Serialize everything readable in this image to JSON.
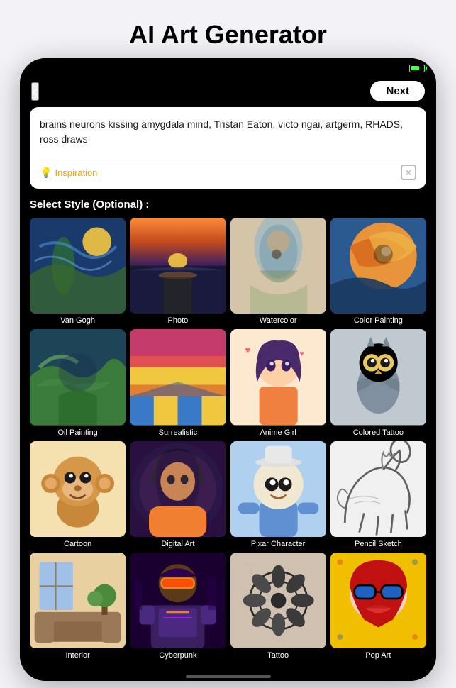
{
  "page": {
    "title": "AI Art Generator"
  },
  "nav": {
    "back_label": "‹",
    "next_label": "Next"
  },
  "prompt": {
    "text": "brains neurons kissing amygdala mind, Tristan Eaton, victo ngai, artgerm, RHADS, ross draws",
    "inspiration_label": "Inspiration",
    "clear_label": "×"
  },
  "styles": {
    "section_label": "Select Style (Optional) :",
    "items": [
      {
        "id": "vangogh",
        "name": "Van Gogh",
        "thumb_class": "thumb-vangogh"
      },
      {
        "id": "photo",
        "name": "Photo",
        "thumb_class": "thumb-photo"
      },
      {
        "id": "watercolor",
        "name": "Watercolor",
        "thumb_class": "thumb-watercolor"
      },
      {
        "id": "colorpainting",
        "name": "Color Painting",
        "thumb_class": "thumb-colorpainting"
      },
      {
        "id": "oilpainting",
        "name": "Oil Painting",
        "thumb_class": "thumb-oilpainting"
      },
      {
        "id": "surrealistic",
        "name": "Surrealistic",
        "thumb_class": "thumb-surrealistic"
      },
      {
        "id": "animegirl",
        "name": "Anime Girl",
        "thumb_class": "thumb-animegirl"
      },
      {
        "id": "coloredtattoo",
        "name": "Colored Tattoo",
        "thumb_class": "thumb-coloredtattoo"
      },
      {
        "id": "cartoon",
        "name": "Cartoon",
        "thumb_class": "thumb-cartoon"
      },
      {
        "id": "digitalart",
        "name": "Digital Art",
        "thumb_class": "thumb-digitalart"
      },
      {
        "id": "pixar",
        "name": "Pixar Character",
        "thumb_class": "thumb-pixar"
      },
      {
        "id": "pencilsketch",
        "name": "Pencil Sketch",
        "thumb_class": "thumb-pencilsketch"
      },
      {
        "id": "interior",
        "name": "Interior",
        "thumb_class": "thumb-interior"
      },
      {
        "id": "cyberpunk",
        "name": "Cyberpunk",
        "thumb_class": "thumb-cyberpunk"
      },
      {
        "id": "tattoo2",
        "name": "Tattoo",
        "thumb_class": "thumb-tattoo2"
      },
      {
        "id": "popart",
        "name": "Pop Art",
        "thumb_class": "thumb-popart"
      }
    ]
  },
  "battery": {
    "color": "#4cff4c"
  }
}
